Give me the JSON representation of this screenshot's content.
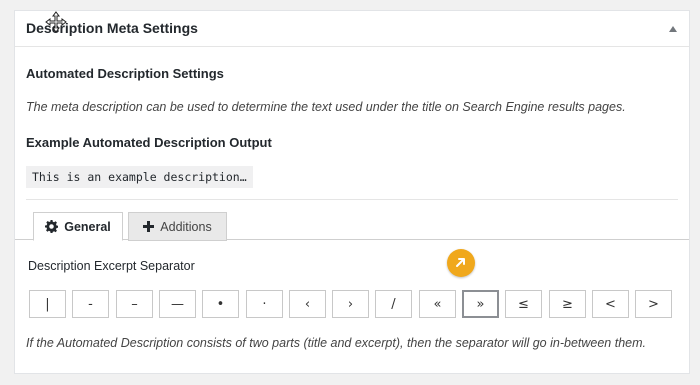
{
  "metabox": {
    "title": "Description Meta Settings"
  },
  "content": {
    "automated_heading": "Automated Description Settings",
    "description": "The meta description can be used to determine the text used under the title on Search Engine results pages.",
    "example_heading": "Example Automated Description Output",
    "example_output": "This is an example description…"
  },
  "tabs": [
    {
      "label": "General",
      "icon": "gear-icon",
      "active": true
    },
    {
      "label": "Additions",
      "icon": "plus-icon",
      "active": false
    }
  ],
  "separator": {
    "heading": "Description Excerpt Separator",
    "options": [
      "|",
      "-",
      "–",
      "—",
      "•",
      "·",
      "‹",
      "›",
      "/",
      "«",
      "»",
      "≤",
      "≥",
      "<",
      ">"
    ],
    "selected": "»",
    "help": "If the Automated Description consists of two parts (title and excerpt), then the separator will go in-between them."
  },
  "colors": {
    "badge": "#f0a81c",
    "accent_text": "#23282d"
  }
}
